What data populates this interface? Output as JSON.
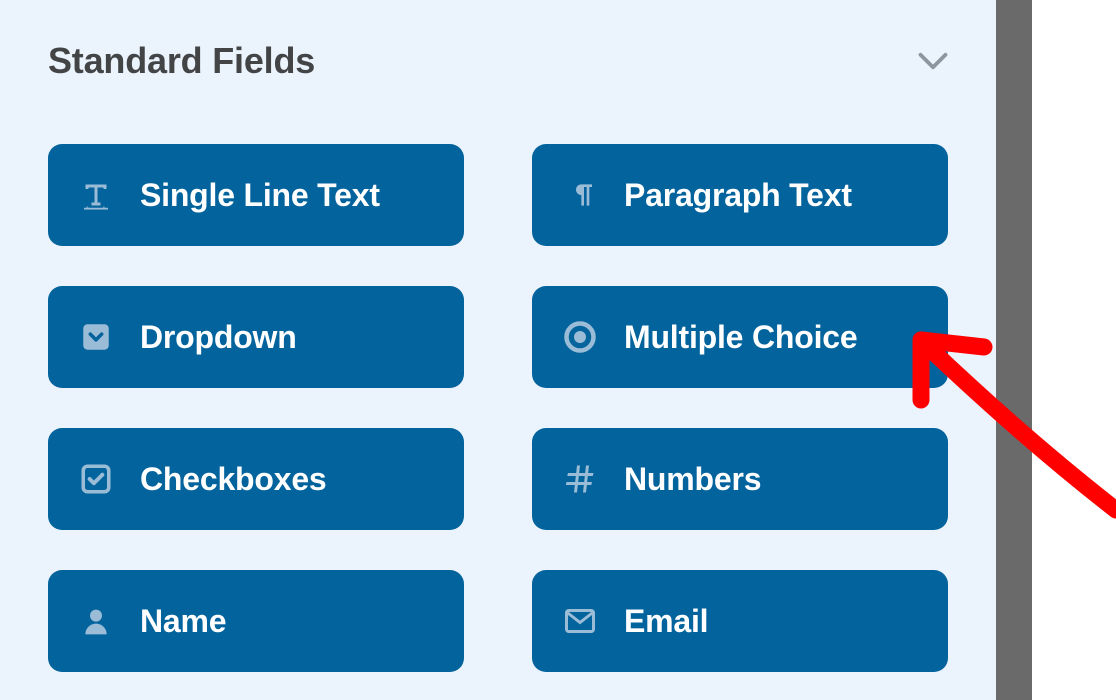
{
  "section": {
    "title": "Standard Fields"
  },
  "fields": [
    {
      "label": "Single Line Text"
    },
    {
      "label": "Paragraph Text"
    },
    {
      "label": "Dropdown"
    },
    {
      "label": "Multiple Choice"
    },
    {
      "label": "Checkboxes"
    },
    {
      "label": "Numbers"
    },
    {
      "label": "Name"
    },
    {
      "label": "Email"
    }
  ]
}
